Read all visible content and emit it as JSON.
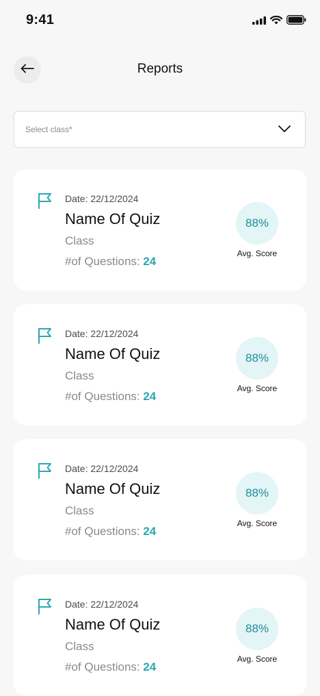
{
  "status_bar": {
    "time": "9:41"
  },
  "header": {
    "title": "Reports"
  },
  "select": {
    "placeholder": "Select class*"
  },
  "colors": {
    "accent": "#2aa7b1",
    "score_bg": "#e3f5f6",
    "score_text": "#1f8f98"
  },
  "icons": {
    "back": "arrow-left-icon",
    "chevron": "chevron-down-icon",
    "flag": "flag-icon"
  },
  "reports": [
    {
      "date": "Date: 22/12/2024",
      "title": "Name Of Quiz",
      "class": "Class",
      "questions_label": "#of Questions: ",
      "questions_count": "24",
      "score": "88%",
      "score_label": "Avg. Score"
    },
    {
      "date": "Date: 22/12/2024",
      "title": "Name Of Quiz",
      "class": "Class",
      "questions_label": "#of Questions: ",
      "questions_count": "24",
      "score": "88%",
      "score_label": "Avg. Score"
    },
    {
      "date": "Date: 22/12/2024",
      "title": "Name Of Quiz",
      "class": "Class",
      "questions_label": "#of Questions: ",
      "questions_count": "24",
      "score": "88%",
      "score_label": "Avg. Score"
    },
    {
      "date": "Date: 22/12/2024",
      "title": "Name Of Quiz",
      "class": "Class",
      "questions_label": "#of Questions: ",
      "questions_count": "24",
      "score": "88%",
      "score_label": "Avg. Score"
    }
  ]
}
